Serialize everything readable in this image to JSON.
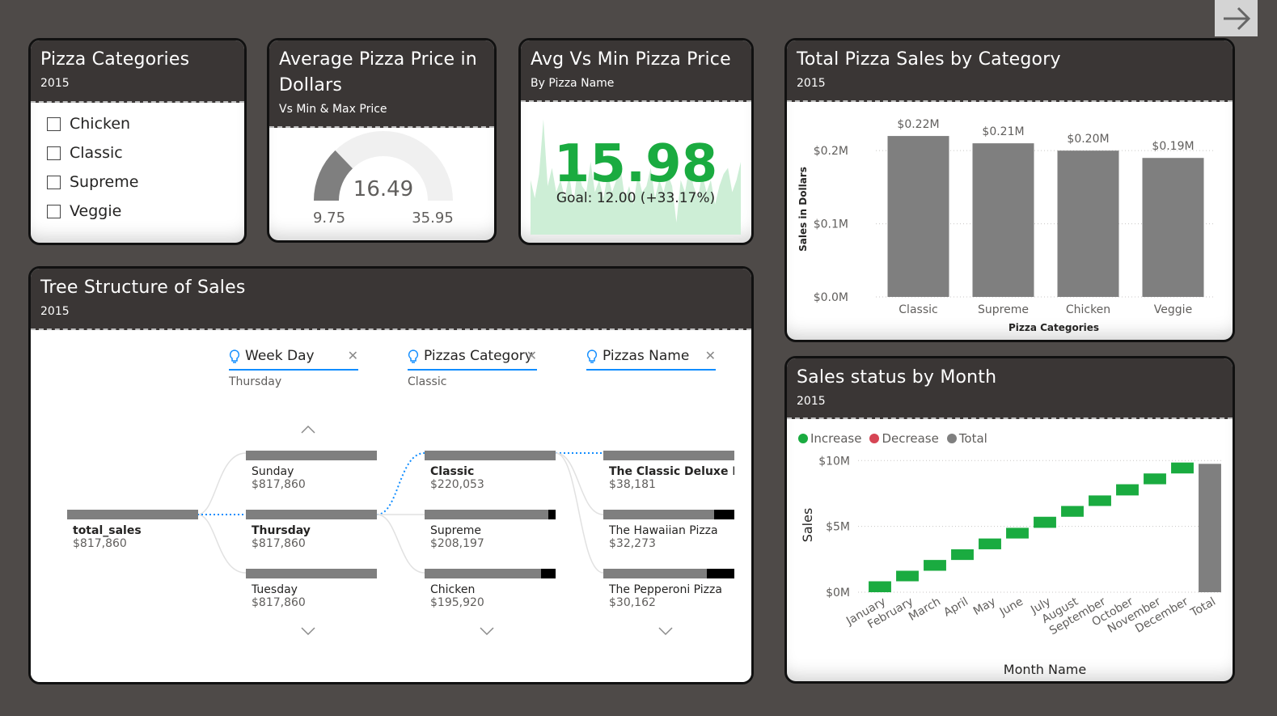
{
  "nav": {
    "icon": "arrow-right-icon"
  },
  "slicer": {
    "title": "Pizza Categories",
    "subtitle": "2015",
    "items": [
      "Chicken",
      "Classic",
      "Supreme",
      "Veggie"
    ]
  },
  "gauge": {
    "title": "Average Pizza Price in Dollars",
    "subtitle": "Vs Min & Max Price",
    "value": "16.49",
    "min": "9.75",
    "max": "35.95",
    "fraction": 0.257
  },
  "kpi": {
    "title": "Avg Vs Min Pizza Price",
    "subtitle": "By Pizza Name",
    "value": "15.98",
    "goal": "Goal: 12.00 (+33.17%)",
    "trend_values": [
      0.45,
      0.3,
      0.5,
      0.95,
      0.4,
      0.55,
      0.35,
      0.45,
      0.3,
      0.5,
      0.25,
      0.55,
      0.4,
      0.35,
      0.6,
      0.35,
      0.45,
      0.3,
      0.5,
      0.35,
      0.45,
      0.55,
      0.3,
      0.4,
      0.25,
      0.5,
      0.35,
      0.4,
      0.55,
      0.3,
      0.45,
      0.35,
      0.5,
      0.4,
      0.1,
      0.45,
      0.35,
      0.55,
      0.4,
      0.3,
      0.5,
      0.35,
      0.45,
      0.25,
      0.4,
      0.5,
      0.55,
      0.35,
      0.45,
      0.6
    ],
    "colors": {
      "good": "#1aab40",
      "fill": "#cdeed6"
    }
  },
  "bar_card": {
    "title": "Total Pizza Sales by Category",
    "subtitle": "2015"
  },
  "tree": {
    "title": "Tree Structure of Sales",
    "subtitle": "2015",
    "levels": [
      {
        "label": "Week Day",
        "selected": "Thursday"
      },
      {
        "label": "Pizzas Category",
        "selected": "Classic"
      },
      {
        "label": "Pizzas Name",
        "selected": ""
      }
    ],
    "root": {
      "name": "total_sales",
      "value": "$817,860"
    },
    "col1": [
      {
        "name": "Sunday",
        "value": "$817,860"
      },
      {
        "name": "Thursday",
        "value": "$817,860"
      },
      {
        "name": "Tuesday",
        "value": "$817,860"
      }
    ],
    "col2": [
      {
        "name": "Classic",
        "value": "$220,053",
        "fill": 1.0
      },
      {
        "name": "Supreme",
        "value": "$208,197",
        "fill": 0.946
      },
      {
        "name": "Chicken",
        "value": "$195,920",
        "fill": 0.89
      }
    ],
    "col3": [
      {
        "name": "The Classic Deluxe Pi...",
        "value": "$38,181",
        "fill": 1.0
      },
      {
        "name": "The Hawaiian Pizza",
        "value": "$32,273",
        "fill": 0.845
      },
      {
        "name": "The Pepperoni Pizza",
        "value": "$30,162",
        "fill": 0.79
      }
    ]
  },
  "waterfall_card": {
    "title": "Sales status by Month",
    "subtitle": "2015",
    "legend": [
      {
        "label": "Increase",
        "color": "#1aab40"
      },
      {
        "label": "Decrease",
        "color": "#d64554"
      },
      {
        "label": "Total",
        "color": "#7f7f7f"
      }
    ]
  },
  "chart_data": [
    {
      "type": "bar",
      "title": "Total Pizza Sales by Category",
      "categories": [
        "Classic",
        "Supreme",
        "Chicken",
        "Veggie"
      ],
      "values": [
        0.22,
        0.21,
        0.2,
        0.19
      ],
      "data_labels": [
        "$0.22M",
        "$0.21M",
        "$0.20M",
        "$0.19M"
      ],
      "xlabel": "Pizza Categories",
      "ylabel": "Sales in Dollars",
      "yticks": [
        "$0.0M",
        "$0.1M",
        "$0.2M"
      ],
      "ylim": [
        0,
        0.24
      ],
      "color": "#7f7f7f",
      "grid": true
    },
    {
      "type": "bar",
      "subtype": "waterfall",
      "title": "Sales status by Month",
      "categories": [
        "January",
        "February",
        "March",
        "April",
        "May",
        "June",
        "July",
        "August",
        "September",
        "October",
        "November",
        "December",
        "Total"
      ],
      "values": [
        0.83,
        0.8,
        0.82,
        0.81,
        0.82,
        0.81,
        0.84,
        0.82,
        0.8,
        0.85,
        0.82,
        0.83,
        9.75
      ],
      "xlabel": "Month Name",
      "ylabel": "Sales",
      "yticks": [
        "$0M",
        "$5M",
        "$10M"
      ],
      "ylim": [
        0,
        10.2
      ],
      "grid": true
    }
  ]
}
